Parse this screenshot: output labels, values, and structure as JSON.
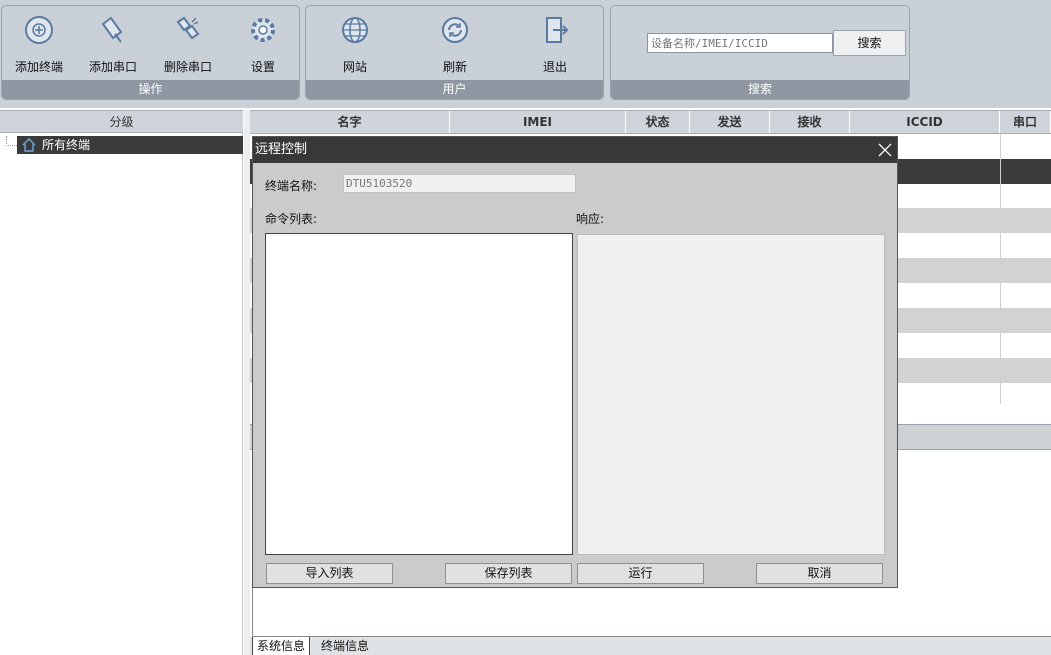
{
  "ribbon": {
    "operations": {
      "caption": "操作",
      "buttons": [
        {
          "label": "添加终端",
          "icon": "add-terminal-icon"
        },
        {
          "label": "添加串口",
          "icon": "add-serial-icon"
        },
        {
          "label": "删除串口",
          "icon": "delete-serial-icon"
        },
        {
          "label": "设置",
          "icon": "gear-icon"
        }
      ]
    },
    "user": {
      "caption": "用户",
      "buttons": [
        {
          "label": "网站",
          "icon": "globe-icon"
        },
        {
          "label": "刷新",
          "icon": "refresh-icon"
        },
        {
          "label": "退出",
          "icon": "exit-icon"
        }
      ]
    },
    "search": {
      "caption": "搜索",
      "placeholder": "设备名称/IMEI/ICCID",
      "button_label": "搜索"
    }
  },
  "tree": {
    "header": "分级",
    "items": [
      {
        "label": "所有终端",
        "icon": "home-icon"
      }
    ]
  },
  "table": {
    "columns": [
      "名字",
      "IMEI",
      "状态",
      "发送",
      "接收",
      "ICCID",
      "串口"
    ]
  },
  "dialog": {
    "title": "远程控制",
    "terminal_name_label": "终端名称:",
    "terminal_name_value": "DTU5103520",
    "command_list_label": "命令列表:",
    "response_label": "响应:",
    "buttons": {
      "import": "导入列表",
      "save": "保存列表",
      "run": "运行",
      "cancel": "取消"
    }
  },
  "bottom_tabs": [
    "系统信息",
    "终端信息"
  ]
}
